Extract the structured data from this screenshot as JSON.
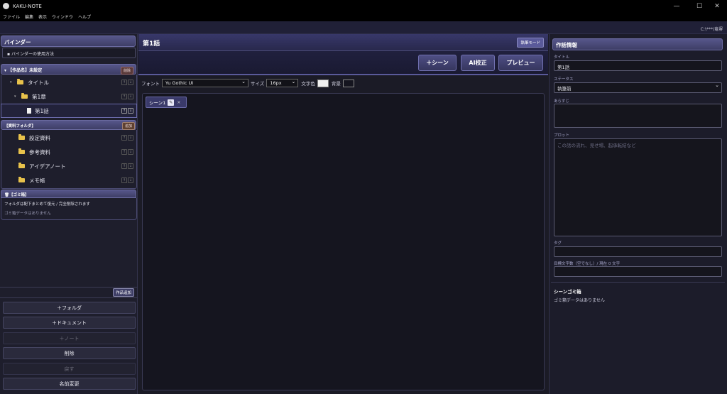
{
  "app": {
    "title": "KAKU-NOTE"
  },
  "menu": [
    "ファイル",
    "編集",
    "表示",
    "ウィンドウ",
    "ヘルプ"
  ],
  "window_controls": {
    "minimize": "—",
    "maximize": "☐",
    "close": "✕"
  },
  "path_display": "C:\\***\\竜塀",
  "sidebar": {
    "binder_title": "バインダー",
    "binder_help": "▪ バインダーの使用方法",
    "work_header": "【作品名】未設定",
    "work_delete": "削除",
    "tree": [
      {
        "label": "タイトル",
        "type": "folder",
        "indent": 1,
        "toggle": "▾"
      },
      {
        "label": "第1章",
        "type": "folder",
        "indent": 2,
        "toggle": "▾"
      },
      {
        "label": "第1話",
        "type": "doc",
        "indent": 3,
        "toggle": ""
      }
    ],
    "materials_header": "【資料フォルダ】",
    "materials_add": "追加",
    "materials": [
      "設定資料",
      "参考資料",
      "アイデアノート",
      "メモ帳"
    ],
    "trash_header": "🗑【ゴミ箱】",
    "trash_note": "フォルダは配下まとめて復元 / 完全削除されます",
    "trash_empty": "ゴミ箱データはありません",
    "add_work": "作品追加",
    "buttons": [
      {
        "label": "＋フォルダ",
        "enabled": true
      },
      {
        "label": "＋ドキュメント",
        "enabled": true
      },
      {
        "label": "＋ノート",
        "enabled": false
      },
      {
        "label": "削除",
        "enabled": true
      },
      {
        "label": "戻す",
        "enabled": false
      },
      {
        "label": "名前変更",
        "enabled": true
      }
    ]
  },
  "editor": {
    "chapter_title": "第1話",
    "mode_badge": "執筆モード",
    "btn_scene": "＋シーン",
    "btn_ai": "AI校正",
    "btn_preview": "プレビュー",
    "font_label": "フォント",
    "font_value": "Yu Gothic UI",
    "size_label": "サイズ",
    "size_value": "16px",
    "text_color_label": "文字色",
    "bg_label": "背景",
    "text_color": "#f0f0f0",
    "bg_color": "#15151f",
    "scene_tab": "シーン1",
    "scene_tab_close": "×"
  },
  "info": {
    "panel_title": "作話情報",
    "title_label": "タイトル",
    "title_value": "第1話",
    "status_label": "ステータス",
    "status_value": "執筆前",
    "synopsis_label": "あらすじ",
    "synopsis_value": "",
    "plot_label": "プロット",
    "plot_placeholder": "この話の流れ、見せ場、起承転結など",
    "tag_label": "タグ",
    "tag_value": "",
    "target_label": "目標文字数（空でなし）/ 現在 0 文字",
    "target_value": "",
    "scene_trash_title": "シーンゴミ箱",
    "scene_trash_empty": "ゴミ箱データはありません"
  }
}
